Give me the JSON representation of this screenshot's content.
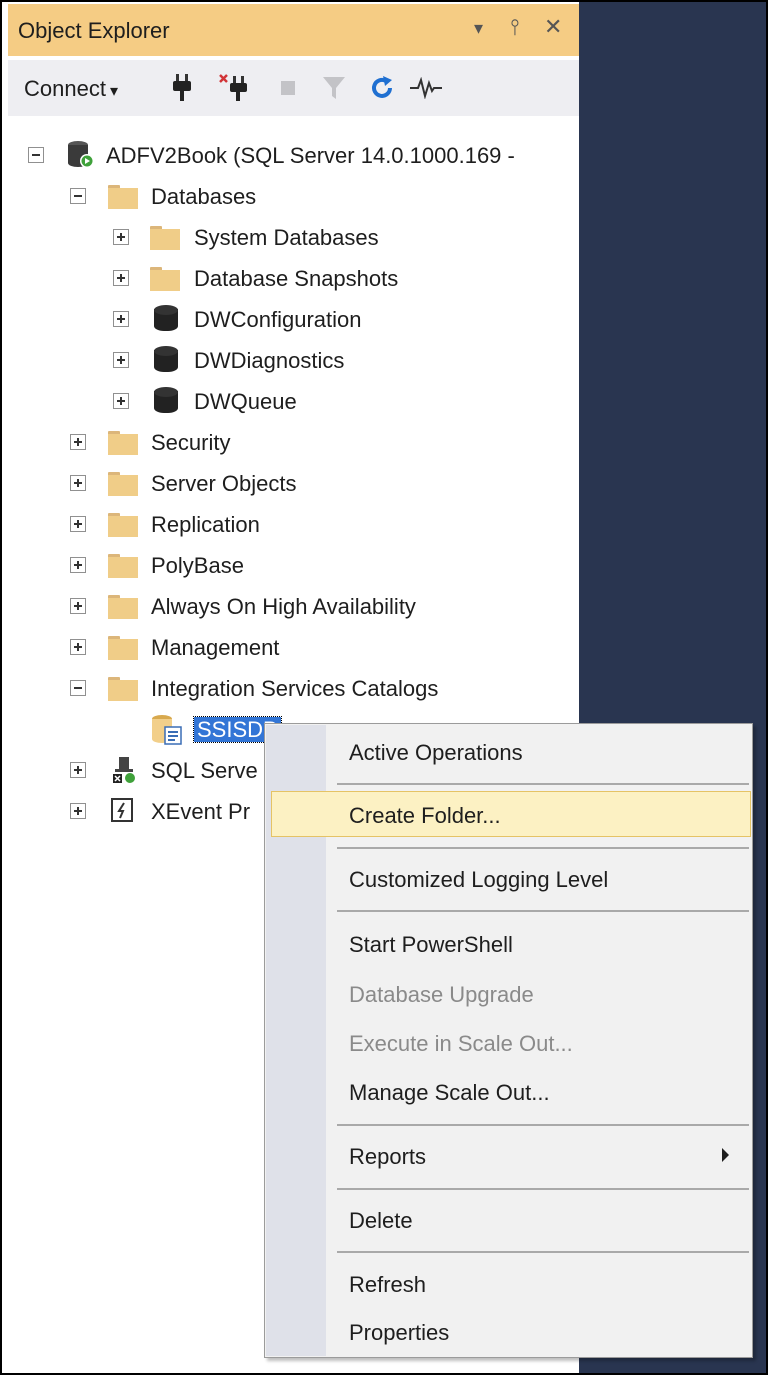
{
  "title_bar": {
    "title": "Object Explorer",
    "controls": [
      "▾",
      "⫯",
      "✕"
    ]
  },
  "toolbar": {
    "connect_label": "Connect",
    "connect_arrow": "▾"
  },
  "tree": {
    "server": "ADFV2Book (SQL Server 14.0.1000.169 -",
    "databases": "Databases",
    "db_children": [
      "System Databases",
      "Database Snapshots",
      "DWConfiguration",
      "DWDiagnostics",
      "DWQueue"
    ],
    "server_children": [
      "Security",
      "Server Objects",
      "Replication",
      "PolyBase",
      "Always On High Availability",
      "Management",
      "Integration Services Catalogs"
    ],
    "ssisdb": "SSISDB",
    "sql_server_agent": "SQL Serve",
    "xevent_profiler": "XEvent Pr"
  },
  "context_menu": {
    "items": [
      "Active Operations",
      "Create Folder...",
      "Customized Logging Level",
      "Start PowerShell",
      "Database Upgrade",
      "Execute in Scale Out...",
      "Manage Scale Out...",
      "Reports",
      "Delete",
      "Refresh",
      "Properties"
    ],
    "highlighted": "Create Folder...",
    "disabled": [
      "Database Upgrade",
      "Execute in Scale Out..."
    ]
  },
  "colors": {
    "title_bar": "#f5cc84",
    "background_dark": "#293550",
    "selection": "#3275d6",
    "menu_highlight": "#fcf1c3"
  }
}
